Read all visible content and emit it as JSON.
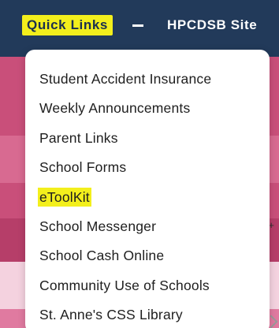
{
  "topnav": {
    "quick_links_label": "Quick Links",
    "separator": "—",
    "site_link_label": "HPCDSB Site"
  },
  "dropdown": {
    "items": [
      {
        "label": "Student Accident Insurance",
        "highlighted": false
      },
      {
        "label": "Weekly Announcements",
        "highlighted": false
      },
      {
        "label": "Parent Links",
        "highlighted": false
      },
      {
        "label": "School Forms",
        "highlighted": false
      },
      {
        "label": "eToolKit",
        "highlighted": true
      },
      {
        "label": "School Messenger",
        "highlighted": false
      },
      {
        "label": "School Cash Online",
        "highlighted": false
      },
      {
        "label": "Community Use of Schools",
        "highlighted": false
      },
      {
        "label": "St. Anne's CSS Library",
        "highlighted": false
      }
    ]
  },
  "colors": {
    "nav_background": "#223a5a",
    "highlight": "#f3ef1c",
    "hero_background": "#c94f7a"
  }
}
